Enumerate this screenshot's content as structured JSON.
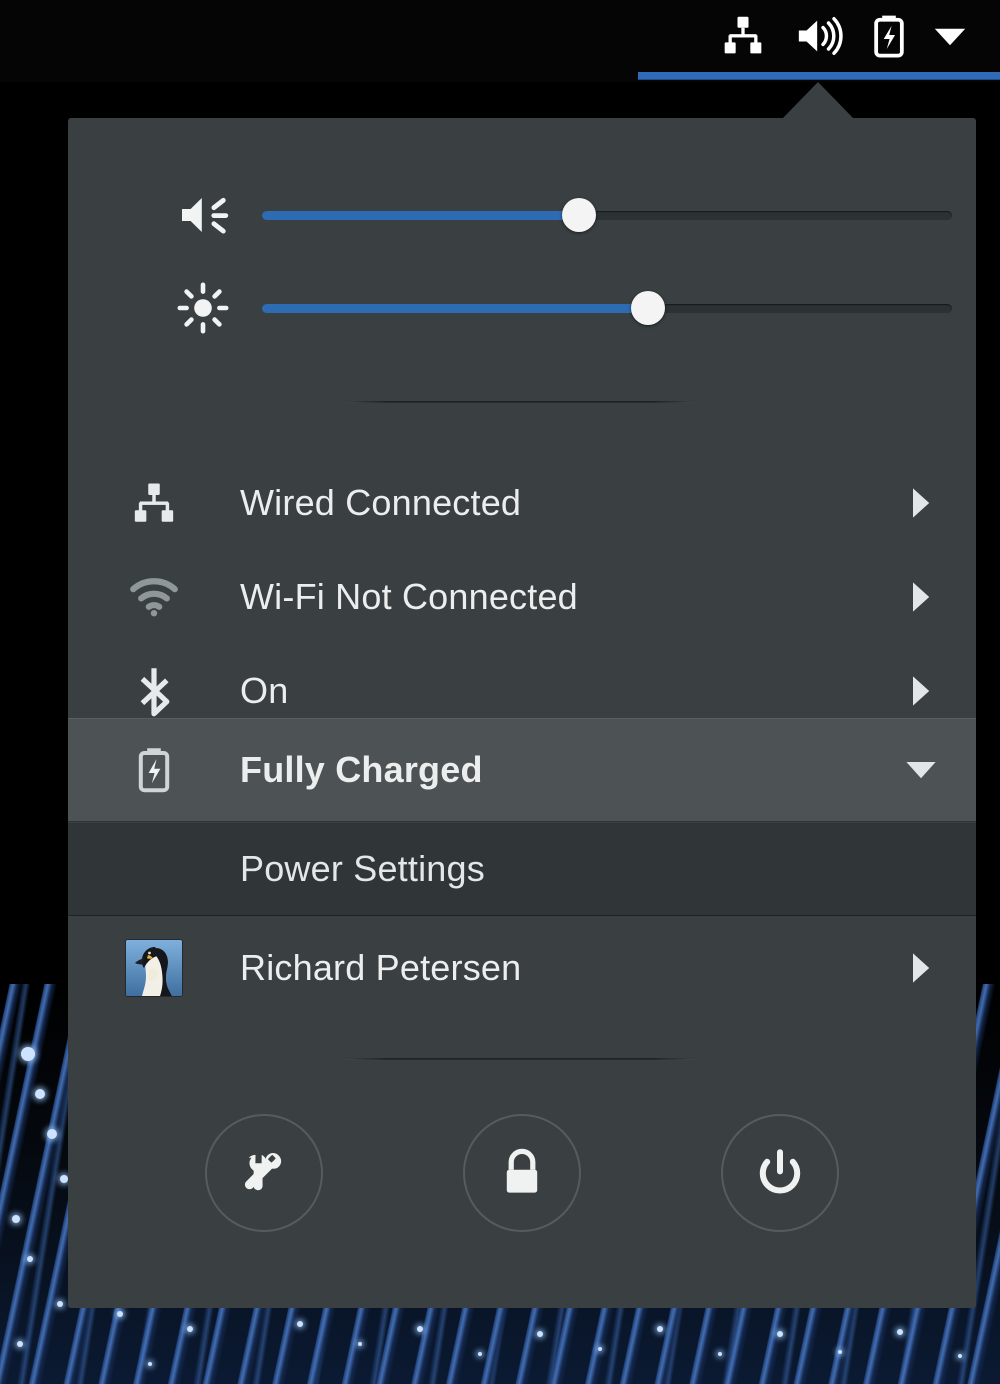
{
  "topbar": {
    "icons": [
      {
        "name": "wired-network-icon",
        "label": "Wired Network"
      },
      {
        "name": "volume-icon",
        "label": "Volume"
      },
      {
        "name": "battery-charging-icon",
        "label": "Battery Charging"
      },
      {
        "name": "chevron-down-icon",
        "label": "System Menu"
      }
    ],
    "accent_color": "#2f6cb5"
  },
  "menu": {
    "background_color": "#3a4042",
    "highlight_color": "#4d5254",
    "submenu_color": "#303537",
    "sliders": [
      {
        "name": "volume-slider",
        "icon": "volume-icon",
        "label": "Volume",
        "value": 46,
        "min": 0,
        "max": 100,
        "fill_color": "#2d6cb4"
      },
      {
        "name": "brightness-slider",
        "icon": "brightness-icon",
        "label": "Brightness",
        "value": 56,
        "min": 0,
        "max": 100,
        "fill_color": "#2d6cb4"
      }
    ],
    "items": [
      {
        "name": "wired",
        "icon": "wired-network-icon",
        "label": "Wired Connected",
        "arrow": "chevron-right-icon"
      },
      {
        "name": "wifi",
        "icon": "wifi-icon",
        "label": "Wi-Fi Not Connected",
        "arrow": "chevron-right-icon"
      },
      {
        "name": "bluetooth",
        "icon": "bluetooth-icon",
        "label": "On",
        "arrow": "chevron-right-icon"
      },
      {
        "name": "battery",
        "icon": "battery-charging-icon",
        "label": "Fully Charged",
        "arrow": "chevron-down-icon",
        "expanded": true
      }
    ],
    "power_settings": {
      "name": "power-settings",
      "label": "Power Settings"
    },
    "user": {
      "name": "user",
      "label": "Richard Petersen",
      "avatar": "penguin-avatar",
      "arrow": "chevron-right-icon"
    },
    "actions": [
      {
        "name": "settings-button",
        "icon": "tools-icon",
        "label": "Settings"
      },
      {
        "name": "lock-button",
        "icon": "lock-icon",
        "label": "Lock"
      },
      {
        "name": "power-button",
        "icon": "power-icon",
        "label": "Power Off"
      }
    ]
  }
}
